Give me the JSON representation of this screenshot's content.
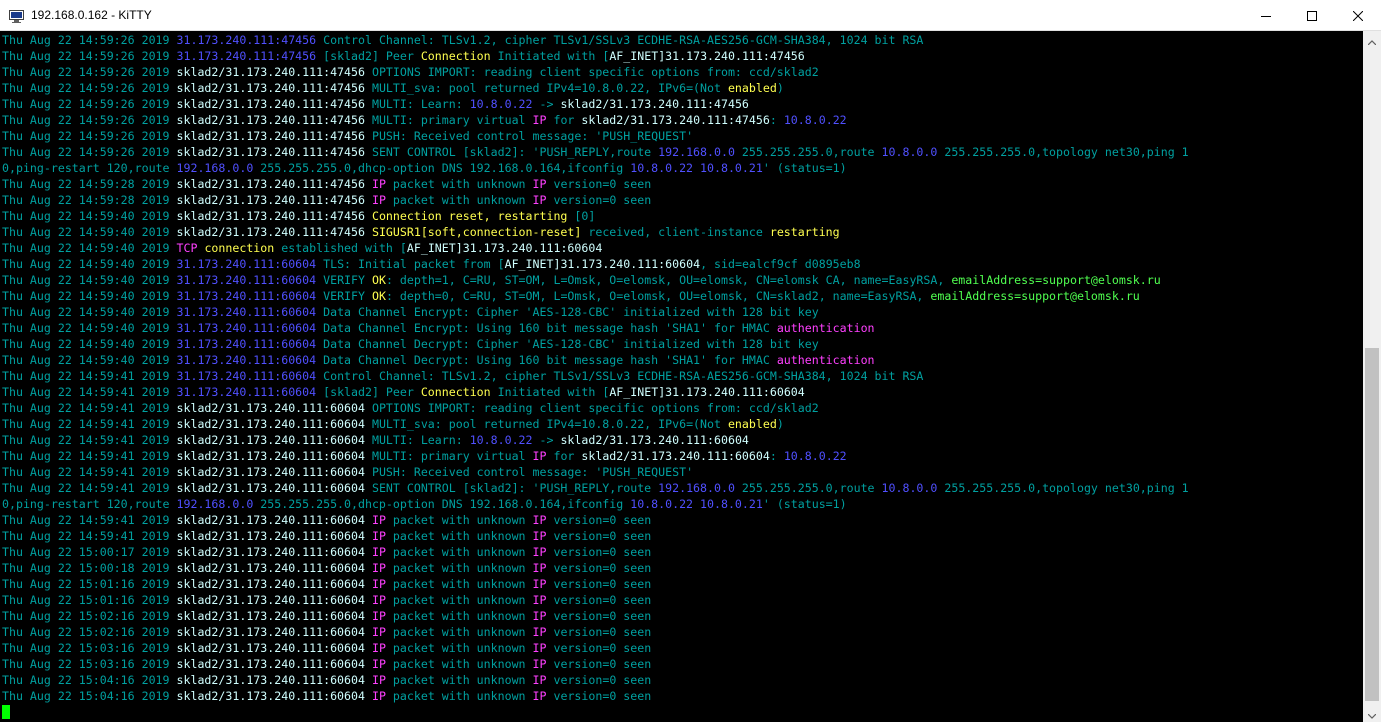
{
  "window": {
    "title": "192.168.0.162 - KiTTY",
    "icon": "kitty-terminal-icon"
  },
  "controls": {
    "minimize_icon": "minimize-icon",
    "maximize_icon": "maximize-icon",
    "close_icon": "close-icon"
  },
  "colors": {
    "background": "#000000",
    "default_text": "#00a0a0",
    "address": "#5050ff",
    "bold": "#d0ffff",
    "magenta": "#ff40ff",
    "yellow": "#ffff50",
    "green": "#50ff50",
    "cursor": "#00ff00"
  },
  "terminal": {
    "lines": [
      [
        [
          "Thu Aug 22 14:59:26 2019 ",
          "def"
        ],
        [
          "31.173.240.111:47456",
          "addr"
        ],
        [
          " Control Channel: TLSv1.2, cipher TLSv1/SSLv3 ECDHE-RSA-AES256-GCM-SHA384, 1024 bit RSA",
          "def"
        ]
      ],
      [
        [
          "Thu Aug 22 14:59:26 2019 ",
          "def"
        ],
        [
          "31.173.240.111:47456",
          "addr"
        ],
        [
          " [sklad2] Peer ",
          "def"
        ],
        [
          "Connection",
          "yel"
        ],
        [
          " Initiated with [",
          "def"
        ],
        [
          "AF_INET",
          "bold"
        ],
        [
          "]31.173.240.111:47456",
          "bold"
        ]
      ],
      [
        [
          "Thu Aug 22 14:59:26 2019 ",
          "def"
        ],
        [
          "sklad2/31.173.240.111:47456",
          "bold"
        ],
        [
          " OPTIONS IMPORT: reading client specific options from: ccd/sklad2",
          "def"
        ]
      ],
      [
        [
          "Thu Aug 22 14:59:26 2019 ",
          "def"
        ],
        [
          "sklad2/31.173.240.111:47456",
          "bold"
        ],
        [
          " MULTI_sva: pool returned IPv4=10.8.0.22, IPv6=(Not ",
          "def"
        ],
        [
          "enabled",
          "yel"
        ],
        [
          ")",
          "def"
        ]
      ],
      [
        [
          "Thu Aug 22 14:59:26 2019 ",
          "def"
        ],
        [
          "sklad2/31.173.240.111:47456",
          "bold"
        ],
        [
          " MULTI: Learn: ",
          "def"
        ],
        [
          "10.8.0.22",
          "addr"
        ],
        [
          " -> ",
          "def"
        ],
        [
          "sklad2/31.173.240.111:47456",
          "bold"
        ]
      ],
      [
        [
          "Thu Aug 22 14:59:26 2019 ",
          "def"
        ],
        [
          "sklad2/31.173.240.111:47456",
          "bold"
        ],
        [
          " MULTI: primary virtual ",
          "def"
        ],
        [
          "IP",
          "pink"
        ],
        [
          " for ",
          "def"
        ],
        [
          "sklad2/31.173.240.111:47456",
          "bold"
        ],
        [
          ": ",
          "def"
        ],
        [
          "10.8.0.22",
          "addr"
        ]
      ],
      [
        [
          "Thu Aug 22 14:59:26 2019 ",
          "def"
        ],
        [
          "sklad2/31.173.240.111:47456",
          "bold"
        ],
        [
          " PUSH: Received control message: 'PUSH_REQUEST'",
          "def"
        ]
      ],
      [
        [
          "Thu Aug 22 14:59:26 2019 ",
          "def"
        ],
        [
          "sklad2/31.173.240.111:47456",
          "bold"
        ],
        [
          " SENT CONTROL [sklad2]: 'PUSH_REPLY,route ",
          "def"
        ],
        [
          "192.168.0.0",
          "addr"
        ],
        [
          " 255.255.255.0,route ",
          "def"
        ],
        [
          "10.8.0.0",
          "addr"
        ],
        [
          " 255.255.255.0,topology net30,ping 1",
          "def"
        ]
      ],
      [
        [
          "0,ping-restart 120,route ",
          "def"
        ],
        [
          "192.168.0.0",
          "addr"
        ],
        [
          " 255.255.255.0,dhcp-option DNS 192.168.0.164,ifconfig ",
          "def"
        ],
        [
          "10.8.0.22",
          "addr"
        ],
        [
          " ",
          "def"
        ],
        [
          "10.8.0.21",
          "addr"
        ],
        [
          "' (status=1)",
          "def"
        ]
      ],
      [
        [
          "Thu Aug 22 14:59:28 2019 ",
          "def"
        ],
        [
          "sklad2/31.173.240.111:47456",
          "bold"
        ],
        [
          " ",
          "def"
        ],
        [
          "IP",
          "pink"
        ],
        [
          " packet with unknown ",
          "def"
        ],
        [
          "IP",
          "pink"
        ],
        [
          " version=0 seen",
          "def"
        ]
      ],
      [
        [
          "Thu Aug 22 14:59:28 2019 ",
          "def"
        ],
        [
          "sklad2/31.173.240.111:47456",
          "bold"
        ],
        [
          " ",
          "def"
        ],
        [
          "IP",
          "pink"
        ],
        [
          " packet with unknown ",
          "def"
        ],
        [
          "IP",
          "pink"
        ],
        [
          " version=0 seen",
          "def"
        ]
      ],
      [
        [
          "Thu Aug 22 14:59:40 2019 ",
          "def"
        ],
        [
          "sklad2/31.173.240.111:47456",
          "bold"
        ],
        [
          " ",
          "def"
        ],
        [
          "Connection reset, ",
          "yel"
        ],
        [
          "restarting",
          "yel"
        ],
        [
          " [0]",
          "def"
        ]
      ],
      [
        [
          "Thu Aug 22 14:59:40 2019 ",
          "def"
        ],
        [
          "sklad2/31.173.240.111:47456",
          "bold"
        ],
        [
          " ",
          "def"
        ],
        [
          "SIGUSR1[soft,connection-reset]",
          "yel"
        ],
        [
          " received, client-instance ",
          "def"
        ],
        [
          "restarting",
          "yel"
        ]
      ],
      [
        [
          "Thu Aug 22 14:59:40 2019 ",
          "def"
        ],
        [
          "TCP",
          "pink"
        ],
        [
          " connection",
          "yel"
        ],
        [
          " established with [",
          "def"
        ],
        [
          "AF_INET",
          "bold"
        ],
        [
          "]31.173.240.111:60604",
          "bold"
        ]
      ],
      [
        [
          "Thu Aug 22 14:59:40 2019 ",
          "def"
        ],
        [
          "31.173.240.111:60604",
          "addr"
        ],
        [
          " TLS: Initial packet from [",
          "def"
        ],
        [
          "AF_INET",
          "bold"
        ],
        [
          "]31.173.240.111:60604",
          "bold"
        ],
        [
          ", sid=ealcf9cf d0895eb8",
          "def"
        ]
      ],
      [
        [
          "Thu Aug 22 14:59:40 2019 ",
          "def"
        ],
        [
          "31.173.240.111:60604",
          "addr"
        ],
        [
          " VERIFY ",
          "def"
        ],
        [
          "OK",
          "yel"
        ],
        [
          ": depth=1, C=RU, ST=OM, L=Omsk, O=elomsk, OU=elomsk, CN=elomsk CA, name=EasyRSA, ",
          "def"
        ],
        [
          "emailAddress=support@elomsk.ru",
          "grn"
        ]
      ],
      [
        [
          "Thu Aug 22 14:59:40 2019 ",
          "def"
        ],
        [
          "31.173.240.111:60604",
          "addr"
        ],
        [
          " VERIFY ",
          "def"
        ],
        [
          "OK",
          "yel"
        ],
        [
          ": depth=0, C=RU, ST=OM, L=Omsk, O=elomsk, OU=elomsk, CN=sklad2, name=EasyRSA, ",
          "def"
        ],
        [
          "emailAddress=support@elomsk.ru",
          "grn"
        ]
      ],
      [
        [
          "Thu Aug 22 14:59:40 2019 ",
          "def"
        ],
        [
          "31.173.240.111:60604",
          "addr"
        ],
        [
          " Data Channel Encrypt: Cipher 'AES-128-CBC' initialized with 128 bit key",
          "def"
        ]
      ],
      [
        [
          "Thu Aug 22 14:59:40 2019 ",
          "def"
        ],
        [
          "31.173.240.111:60604",
          "addr"
        ],
        [
          " Data Channel Encrypt: Using 160 bit message hash 'SHA1' for HMAC ",
          "def"
        ],
        [
          "authentication",
          "pink"
        ]
      ],
      [
        [
          "Thu Aug 22 14:59:40 2019 ",
          "def"
        ],
        [
          "31.173.240.111:60604",
          "addr"
        ],
        [
          " Data Channel Decrypt: Cipher 'AES-128-CBC' initialized with 128 bit key",
          "def"
        ]
      ],
      [
        [
          "Thu Aug 22 14:59:40 2019 ",
          "def"
        ],
        [
          "31.173.240.111:60604",
          "addr"
        ],
        [
          " Data Channel Decrypt: Using 160 bit message hash 'SHA1' for HMAC ",
          "def"
        ],
        [
          "authentication",
          "pink"
        ]
      ],
      [
        [
          "Thu Aug 22 14:59:41 2019 ",
          "def"
        ],
        [
          "31.173.240.111:60604",
          "addr"
        ],
        [
          " Control Channel: TLSv1.2, cipher TLSv1/SSLv3 ECDHE-RSA-AES256-GCM-SHA384, 1024 bit RSA",
          "def"
        ]
      ],
      [
        [
          "Thu Aug 22 14:59:41 2019 ",
          "def"
        ],
        [
          "31.173.240.111:60604",
          "addr"
        ],
        [
          " [sklad2] Peer ",
          "def"
        ],
        [
          "Connection",
          "yel"
        ],
        [
          " Initiated with [",
          "def"
        ],
        [
          "AF_INET",
          "bold"
        ],
        [
          "]31.173.240.111:60604",
          "bold"
        ]
      ],
      [
        [
          "Thu Aug 22 14:59:41 2019 ",
          "def"
        ],
        [
          "sklad2/31.173.240.111:60604",
          "bold"
        ],
        [
          " OPTIONS IMPORT: reading client specific options from: ccd/sklad2",
          "def"
        ]
      ],
      [
        [
          "Thu Aug 22 14:59:41 2019 ",
          "def"
        ],
        [
          "sklad2/31.173.240.111:60604",
          "bold"
        ],
        [
          " MULTI_sva: pool returned IPv4=10.8.0.22, IPv6=(Not ",
          "def"
        ],
        [
          "enabled",
          "yel"
        ],
        [
          ")",
          "def"
        ]
      ],
      [
        [
          "Thu Aug 22 14:59:41 2019 ",
          "def"
        ],
        [
          "sklad2/31.173.240.111:60604",
          "bold"
        ],
        [
          " MULTI: Learn: ",
          "def"
        ],
        [
          "10.8.0.22",
          "addr"
        ],
        [
          " -> ",
          "def"
        ],
        [
          "sklad2/31.173.240.111:60604",
          "bold"
        ]
      ],
      [
        [
          "Thu Aug 22 14:59:41 2019 ",
          "def"
        ],
        [
          "sklad2/31.173.240.111:60604",
          "bold"
        ],
        [
          " MULTI: primary virtual ",
          "def"
        ],
        [
          "IP",
          "pink"
        ],
        [
          " for ",
          "def"
        ],
        [
          "sklad2/31.173.240.111:60604",
          "bold"
        ],
        [
          ": ",
          "def"
        ],
        [
          "10.8.0.22",
          "addr"
        ]
      ],
      [
        [
          "Thu Aug 22 14:59:41 2019 ",
          "def"
        ],
        [
          "sklad2/31.173.240.111:60604",
          "bold"
        ],
        [
          " PUSH: Received control message: 'PUSH_REQUEST'",
          "def"
        ]
      ],
      [
        [
          "Thu Aug 22 14:59:41 2019 ",
          "def"
        ],
        [
          "sklad2/31.173.240.111:60604",
          "bold"
        ],
        [
          " SENT CONTROL [sklad2]: 'PUSH_REPLY,route ",
          "def"
        ],
        [
          "192.168.0.0",
          "addr"
        ],
        [
          " 255.255.255.0,route ",
          "def"
        ],
        [
          "10.8.0.0",
          "addr"
        ],
        [
          " 255.255.255.0,topology net30,ping 1",
          "def"
        ]
      ],
      [
        [
          "0,ping-restart 120,route ",
          "def"
        ],
        [
          "192.168.0.0",
          "addr"
        ],
        [
          " 255.255.255.0,dhcp-option DNS 192.168.0.164,ifconfig ",
          "def"
        ],
        [
          "10.8.0.22",
          "addr"
        ],
        [
          " ",
          "def"
        ],
        [
          "10.8.0.21",
          "addr"
        ],
        [
          "' (status=1)",
          "def"
        ]
      ],
      [
        [
          "Thu Aug 22 14:59:41 2019 ",
          "def"
        ],
        [
          "sklad2/31.173.240.111:60604",
          "bold"
        ],
        [
          " ",
          "def"
        ],
        [
          "IP",
          "pink"
        ],
        [
          " packet with unknown ",
          "def"
        ],
        [
          "IP",
          "pink"
        ],
        [
          " version=0 seen",
          "def"
        ]
      ],
      [
        [
          "Thu Aug 22 14:59:41 2019 ",
          "def"
        ],
        [
          "sklad2/31.173.240.111:60604",
          "bold"
        ],
        [
          " ",
          "def"
        ],
        [
          "IP",
          "pink"
        ],
        [
          " packet with unknown ",
          "def"
        ],
        [
          "IP",
          "pink"
        ],
        [
          " version=0 seen",
          "def"
        ]
      ],
      [
        [
          "Thu Aug 22 15:00:17 2019 ",
          "def"
        ],
        [
          "sklad2/31.173.240.111:60604",
          "bold"
        ],
        [
          " ",
          "def"
        ],
        [
          "IP",
          "pink"
        ],
        [
          " packet with unknown ",
          "def"
        ],
        [
          "IP",
          "pink"
        ],
        [
          " version=0 seen",
          "def"
        ]
      ],
      [
        [
          "Thu Aug 22 15:00:18 2019 ",
          "def"
        ],
        [
          "sklad2/31.173.240.111:60604",
          "bold"
        ],
        [
          " ",
          "def"
        ],
        [
          "IP",
          "pink"
        ],
        [
          " packet with unknown ",
          "def"
        ],
        [
          "IP",
          "pink"
        ],
        [
          " version=0 seen",
          "def"
        ]
      ],
      [
        [
          "Thu Aug 22 15:01:16 2019 ",
          "def"
        ],
        [
          "sklad2/31.173.240.111:60604",
          "bold"
        ],
        [
          " ",
          "def"
        ],
        [
          "IP",
          "pink"
        ],
        [
          " packet with unknown ",
          "def"
        ],
        [
          "IP",
          "pink"
        ],
        [
          " version=0 seen",
          "def"
        ]
      ],
      [
        [
          "Thu Aug 22 15:01:16 2019 ",
          "def"
        ],
        [
          "sklad2/31.173.240.111:60604",
          "bold"
        ],
        [
          " ",
          "def"
        ],
        [
          "IP",
          "pink"
        ],
        [
          " packet with unknown ",
          "def"
        ],
        [
          "IP",
          "pink"
        ],
        [
          " version=0 seen",
          "def"
        ]
      ],
      [
        [
          "Thu Aug 22 15:02:16 2019 ",
          "def"
        ],
        [
          "sklad2/31.173.240.111:60604",
          "bold"
        ],
        [
          " ",
          "def"
        ],
        [
          "IP",
          "pink"
        ],
        [
          " packet with unknown ",
          "def"
        ],
        [
          "IP",
          "pink"
        ],
        [
          " version=0 seen",
          "def"
        ]
      ],
      [
        [
          "Thu Aug 22 15:02:16 2019 ",
          "def"
        ],
        [
          "sklad2/31.173.240.111:60604",
          "bold"
        ],
        [
          " ",
          "def"
        ],
        [
          "IP",
          "pink"
        ],
        [
          " packet with unknown ",
          "def"
        ],
        [
          "IP",
          "pink"
        ],
        [
          " version=0 seen",
          "def"
        ]
      ],
      [
        [
          "Thu Aug 22 15:03:16 2019 ",
          "def"
        ],
        [
          "sklad2/31.173.240.111:60604",
          "bold"
        ],
        [
          " ",
          "def"
        ],
        [
          "IP",
          "pink"
        ],
        [
          " packet with unknown ",
          "def"
        ],
        [
          "IP",
          "pink"
        ],
        [
          " version=0 seen",
          "def"
        ]
      ],
      [
        [
          "Thu Aug 22 15:03:16 2019 ",
          "def"
        ],
        [
          "sklad2/31.173.240.111:60604",
          "bold"
        ],
        [
          " ",
          "def"
        ],
        [
          "IP",
          "pink"
        ],
        [
          " packet with unknown ",
          "def"
        ],
        [
          "IP",
          "pink"
        ],
        [
          " version=0 seen",
          "def"
        ]
      ],
      [
        [
          "Thu Aug 22 15:04:16 2019 ",
          "def"
        ],
        [
          "sklad2/31.173.240.111:60604",
          "bold"
        ],
        [
          " ",
          "def"
        ],
        [
          "IP",
          "pink"
        ],
        [
          " packet with unknown ",
          "def"
        ],
        [
          "IP",
          "pink"
        ],
        [
          " version=0 seen",
          "def"
        ]
      ],
      [
        [
          "Thu Aug 22 15:04:16 2019 ",
          "def"
        ],
        [
          "sklad2/31.173.240.111:60604",
          "bold"
        ],
        [
          " ",
          "def"
        ],
        [
          "IP",
          "pink"
        ],
        [
          " packet with unknown ",
          "def"
        ],
        [
          "IP",
          "pink"
        ],
        [
          " version=0 seen",
          "def"
        ]
      ]
    ]
  }
}
